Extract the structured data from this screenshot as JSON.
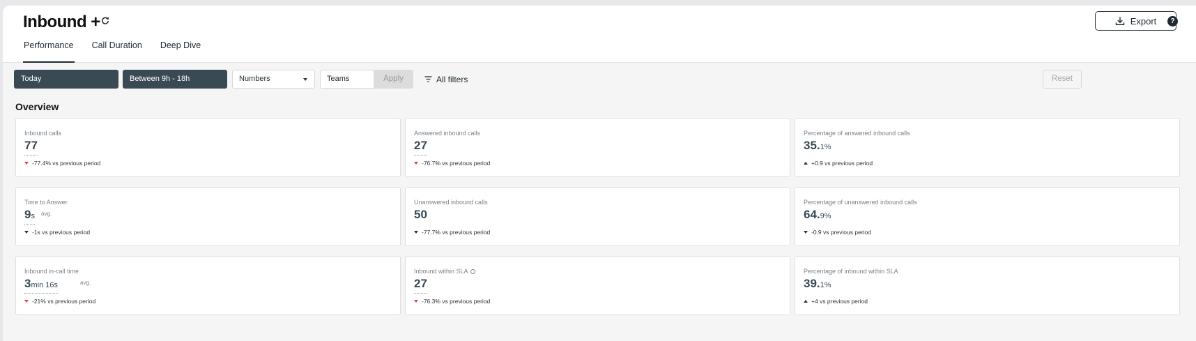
{
  "header": {
    "title": "Inbound +",
    "export_label": "Export",
    "help_glyph": "?",
    "tabs": [
      "Performance",
      "Call Duration",
      "Deep Dive"
    ]
  },
  "filters": {
    "date": "Today",
    "hours": "Between 9h - 18h",
    "numbers": "Numbers",
    "teams": "Teams",
    "apply": "Apply",
    "all_filters": "All filters",
    "reset": "Reset"
  },
  "overview": {
    "title": "Overview",
    "cards": [
      {
        "label": "Inbound calls",
        "value": "77",
        "unit": "",
        "avg": "",
        "delta": "-77.4% vs previous period",
        "trend": "down-red"
      },
      {
        "label": "Answered inbound calls",
        "value": "27",
        "unit": "",
        "avg": "",
        "delta": "-76.7% vs previous period",
        "trend": "down-red"
      },
      {
        "label": "Percentage of answered inbound calls",
        "value": "35.",
        "unit": "1%",
        "avg": "",
        "delta": "+0.9 vs previous period",
        "trend": "up"
      },
      {
        "label": "Time to Answer",
        "value": "9",
        "unit": "s",
        "avg": "avg.",
        "delta": "-1s vs previous period",
        "trend": "down-dark"
      },
      {
        "label": "Unanswered inbound calls",
        "value": "50",
        "unit": "",
        "avg": "",
        "delta": "-77.7% vs previous period",
        "trend": "down-dark"
      },
      {
        "label": "Percentage of unanswered inbound calls",
        "value": "64.",
        "unit": "9%",
        "avg": "",
        "delta": "-0.9 vs previous period",
        "trend": "down-dark"
      },
      {
        "label": "Inbound in-call time",
        "value": "3",
        "unit": "min 16s",
        "avg": "avg.",
        "delta": "-21% vs previous period",
        "trend": "down-red"
      },
      {
        "label": "Inbound within SLA",
        "value": "27",
        "unit": "",
        "avg": "",
        "delta": "-76.3% vs previous period",
        "trend": "down-red",
        "info_icon": true
      },
      {
        "label": "Percentage of inbound within SLA",
        "value": "39.",
        "unit": "1%",
        "avg": "",
        "delta": "+4 vs previous period",
        "trend": "up"
      }
    ]
  },
  "colors": {
    "accent_dark": "#3a4a54",
    "negative": "#e0403a"
  },
  "icons": [
    "refresh-icon",
    "download-icon",
    "help-icon",
    "filter-icon",
    "chevron-down-icon",
    "info-icon",
    "trend-down-icon",
    "trend-up-icon"
  ]
}
